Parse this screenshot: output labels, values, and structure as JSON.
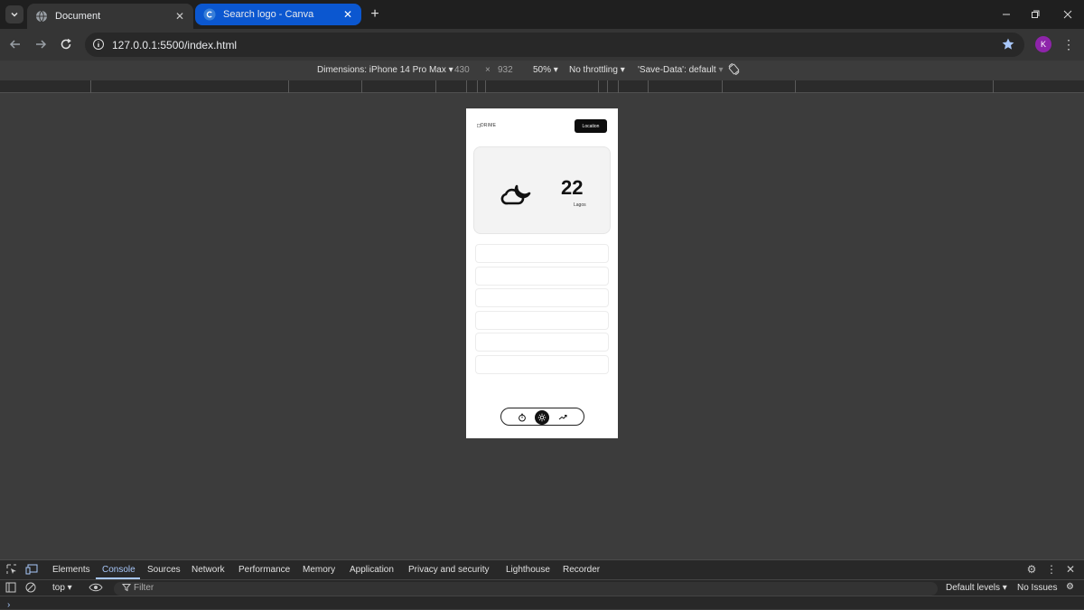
{
  "browser": {
    "tabs": [
      {
        "title": "Document",
        "icon": "globe-icon",
        "active": true
      },
      {
        "title": "Search logo - Canva",
        "icon": "canva-icon",
        "active": false
      }
    ],
    "url": "127.0.0.1:5500/index.html",
    "profile_initial": "K"
  },
  "device_toolbar": {
    "dimensions_label": "Dimensions: iPhone 14 Pro Max",
    "width": "430",
    "times": "×",
    "height": "932",
    "zoom": "50%",
    "throttling": "No throttling",
    "save_data": "'Save-Data': default"
  },
  "app": {
    "logo_alt": "DRIME",
    "location_button": "Location",
    "weather": {
      "temperature": "22",
      "city": "Lagos",
      "icon": "cloud-moon-icon"
    },
    "list_rows": 6,
    "bottom_nav": [
      {
        "icon": "timer-icon",
        "active": false
      },
      {
        "icon": "sun-icon",
        "active": true
      },
      {
        "icon": "share-icon",
        "active": false
      }
    ]
  },
  "devtools": {
    "tabs": [
      "Elements",
      "Console",
      "Sources",
      "Network",
      "Performance",
      "Memory",
      "Application",
      "Privacy and security",
      "Lighthouse",
      "Recorder"
    ],
    "active_tab": "Console",
    "context": "top",
    "filter_placeholder": "Filter",
    "levels": "Default levels",
    "issues": "No Issues"
  },
  "colors": {
    "accent": "#a8c7fa",
    "canva_tab": "#0b57d0",
    "profile": "#8e24aa"
  }
}
